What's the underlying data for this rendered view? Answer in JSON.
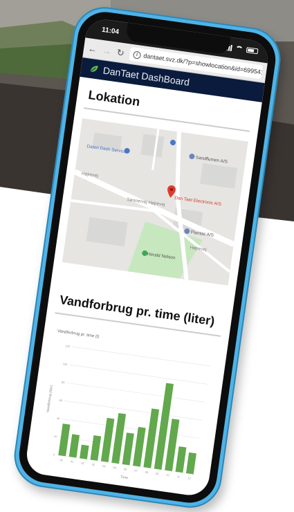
{
  "statusbar": {
    "time": "11:04"
  },
  "browser": {
    "url": "dantaet.svz.dk/?p=showlocation&id=69954108"
  },
  "app": {
    "title": "DanTaet DashBoard"
  },
  "location": {
    "heading": "Lokation",
    "map_labels": {
      "poi_top_left": "Dateri Dash Service",
      "poi_right": "Sandflumen A/S",
      "poi_pin": "Dan Taet Electronic A/S",
      "poi_mid_right": "Plantas A/S",
      "poi_park": "Herald Nelson",
      "road_1": "Højrevej",
      "road_2": "Sønnervej Højrevej",
      "road_3": "Højrevej"
    }
  },
  "consumption": {
    "heading": "Vandforbrug pr. time (liter)"
  },
  "chart_data": {
    "type": "bar",
    "title": "Vandforbrug pr. time (l)",
    "xlabel": "Time",
    "ylabel": "Vandforbrug (liter)",
    "categories": [
      "00",
      "01",
      "02",
      "03",
      "04",
      "05",
      "06",
      "07",
      "08",
      "09",
      "10",
      "11",
      "12"
    ],
    "values": [
      35,
      25,
      15,
      27,
      48,
      55,
      35,
      43,
      65,
      95,
      57,
      28,
      23
    ],
    "ylim": [
      0,
      120
    ],
    "grid": true,
    "colors": {
      "bar": "#62a84d",
      "grid": "#e3e3e3"
    }
  }
}
